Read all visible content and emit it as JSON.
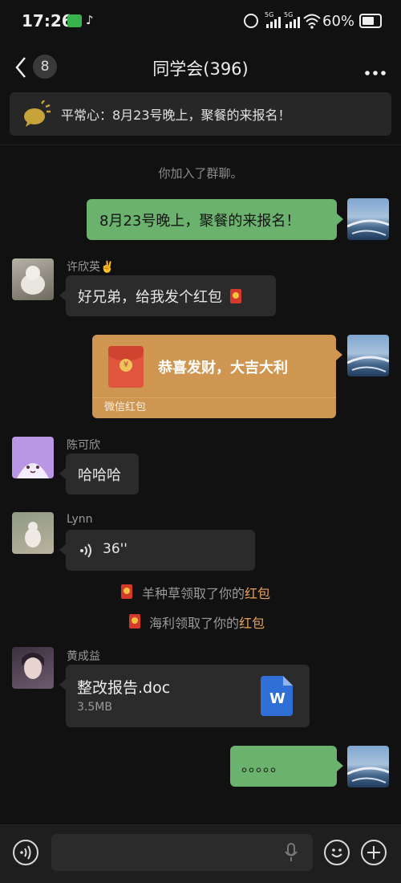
{
  "status_bar": {
    "time": "17:26",
    "battery_text": "60%",
    "signal_1": "5G",
    "signal_2": "5G"
  },
  "header": {
    "back_badge": "8",
    "title": "同学会(396)"
  },
  "pinned": {
    "text": "平常心：8月23号晚上，聚餐的来报名！"
  },
  "messages": {
    "system_join": "你加入了群聊。",
    "m1_text": "8月23号晚上，聚餐的来报名！",
    "m2_name": "许欣英✌️",
    "m2_text": "好兄弟，给我发个红包",
    "m3_title": "恭喜发财，大吉大利",
    "m3_sub": "微信红包",
    "m4_name": "陈可欣",
    "m4_text": "哈哈哈",
    "m5_name": "Lynn",
    "m5_voice": "36''",
    "sys_rp1_prefix": "羊种草领取了你的",
    "sys_rp1_hl": "红包",
    "sys_rp2_prefix": "海利领取了你的",
    "sys_rp2_hl": "红包",
    "m6_name": "黄成益",
    "m6_file": "整改报告.doc",
    "m6_size": "3.5MB",
    "m6_file_icon": "W",
    "m7_text": "。。。。。"
  },
  "colors": {
    "background": "#111111",
    "green_bubble": "#6ab26d",
    "red_packet": "#cf9651",
    "highlight": "#e6a15a"
  }
}
